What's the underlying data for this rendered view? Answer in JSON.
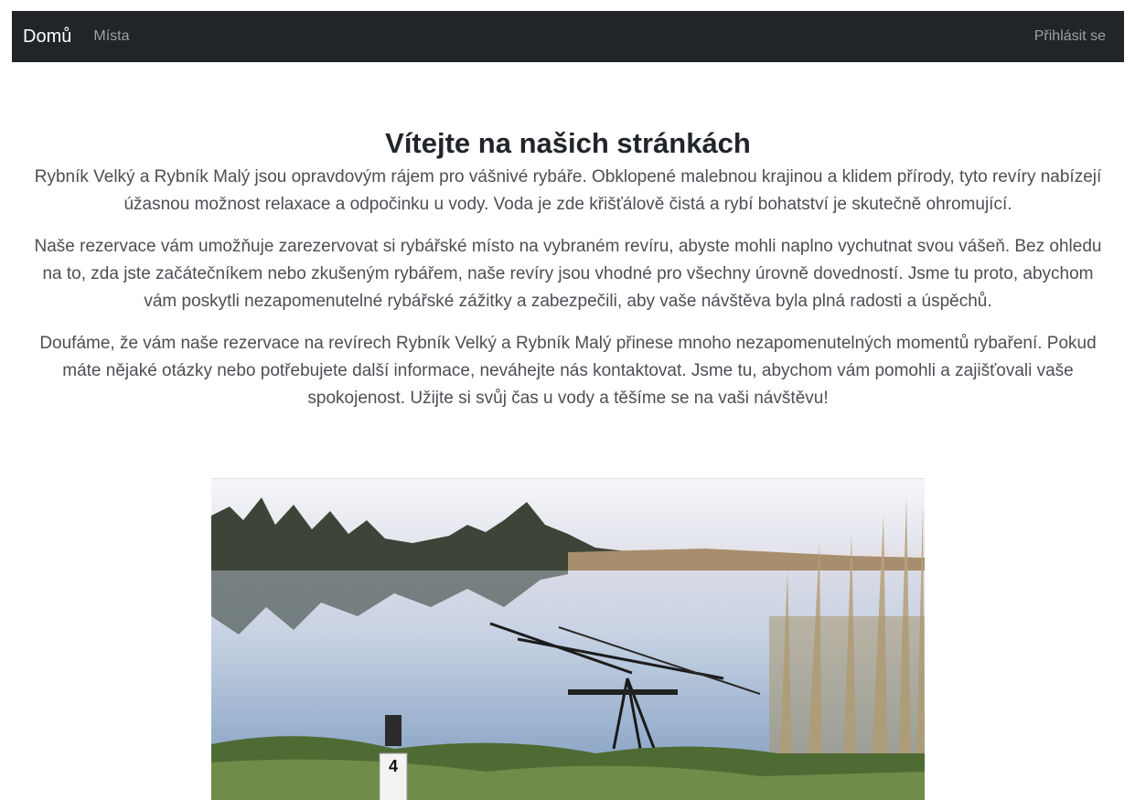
{
  "navbar": {
    "brand": "Domů",
    "links": [
      {
        "label": "Místa"
      }
    ],
    "login_label": "Přihlásit se"
  },
  "main": {
    "title": "Vítejte na našich stránkách",
    "paragraphs": [
      "Rybník Velký a Rybník Malý jsou opravdovým rájem pro vášnivé rybáře. Obklopené malebnou krajinou a klidem přírody, tyto revíry nabízejí úžasnou možnost relaxace a odpočinku u vody. Voda je zde křišťálově čistá a rybí bohatství je skutečně ohromující.",
      "Naše rezervace vám umožňuje zarezervovat si rybářské místo na vybraném revíru, abyste mohli naplno vychutnat svou vášeň. Bez ohledu na to, zda jste začátečníkem nebo zkušeným rybářem, naše revíry jsou vhodné pro všechny úrovně dovedností. Jsme tu proto, abychom vám poskytli nezapomenutelné rybářské zážitky a zabezpečili, aby vaše návštěva byla plná radosti a úspěchů.",
      "Doufáme, že vám naše rezervace na revírech Rybník Velký a Rybník Malý přinese mnoho nezapomenutelných momentů rybaření. Pokud máte nějaké otázky nebo potřebujete další informace, neváhejte nás kontaktovat. Jsme tu, abychom vám pomohli a zajišťovali vaše spokojenost. Užijte si svůj čas u vody a těšíme se na vaši návštěvu!"
    ]
  },
  "hero_image": {
    "peg_number": "4"
  }
}
